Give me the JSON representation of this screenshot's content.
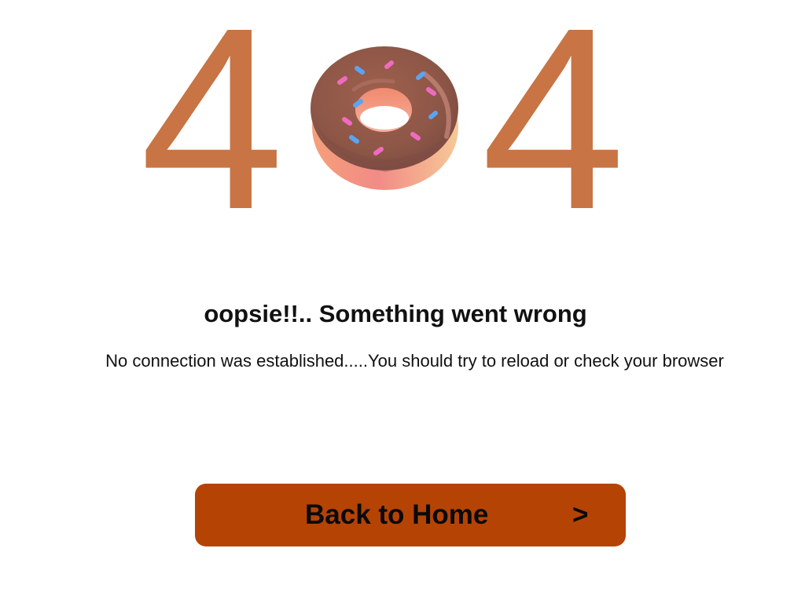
{
  "hero": {
    "digit_left": "4",
    "digit_right": "4",
    "center_image": "donut-icon",
    "digit_color": "#c87444"
  },
  "headline": "oopsie!!.. Something went wrong",
  "message": "No connection was established.....You should try to reload or check your browser",
  "button": {
    "label": "Back to Home",
    "arrow": ">",
    "color": "#b54304"
  }
}
